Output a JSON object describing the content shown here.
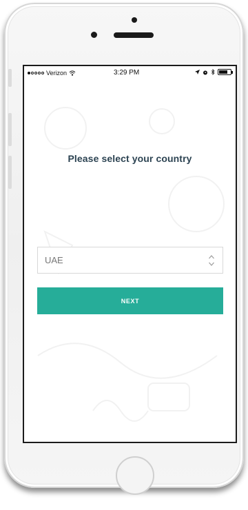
{
  "status_bar": {
    "carrier": "Verizon",
    "time": "3:29 PM",
    "signal_bars_filled": 1,
    "battery_level": 0.75
  },
  "main": {
    "title": "Please select your country",
    "country_select": {
      "selected_value": "UAE"
    },
    "next_button": {
      "label": "NEXT"
    }
  },
  "colors": {
    "accent": "#26ad99",
    "title_text": "#2c4352"
  },
  "icons": {
    "select": "chevron-up-down-icon",
    "wifi": "wifi-icon",
    "location": "location-arrow-icon",
    "alarm": "alarm-icon",
    "bluetooth": "bluetooth-icon",
    "battery": "battery-icon"
  }
}
